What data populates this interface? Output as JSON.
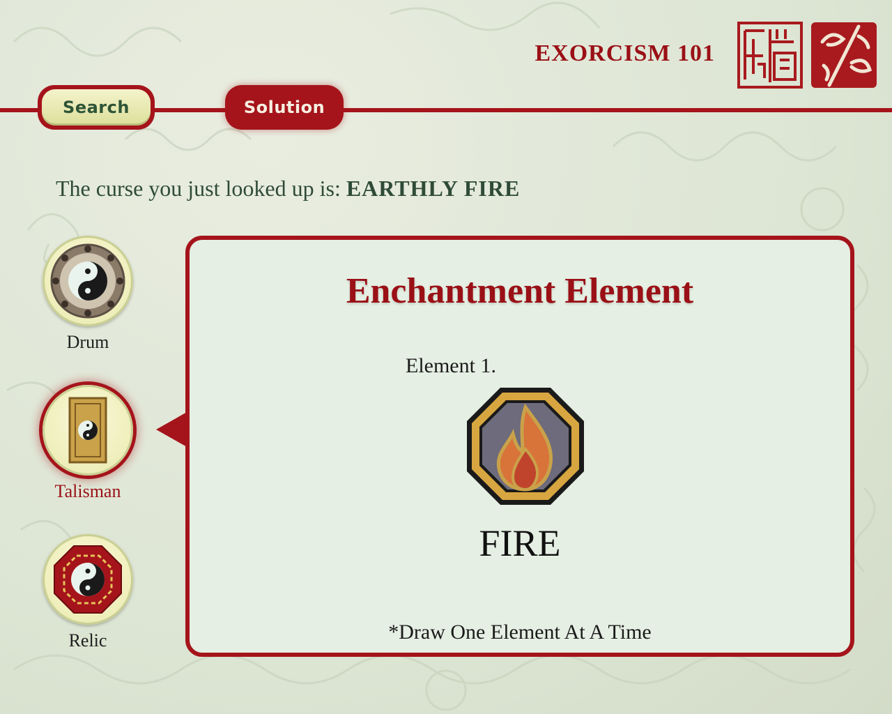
{
  "header": {
    "title": "EXORCISM 101",
    "tabs": {
      "search_label": "Search",
      "solution_label": "Solution"
    }
  },
  "curse": {
    "prefix": "The curse you just looked up is:",
    "name": "EARTHLY FIRE"
  },
  "nav": {
    "items": [
      {
        "label": "Drum",
        "icon": "drum-icon",
        "selected": false
      },
      {
        "label": "Talisman",
        "icon": "talisman-icon",
        "selected": true
      },
      {
        "label": "Relic",
        "icon": "relic-icon",
        "selected": false
      }
    ]
  },
  "panel": {
    "title": "Enchantment Element",
    "element_label": "Element 1.",
    "element_icon": "fire-element-icon",
    "element_name": "FIRE",
    "note": "*Draw One Element At A Time"
  },
  "colors": {
    "accent_red": "#a5141b",
    "title_red": "#9a1016",
    "text_green": "#2f4b38",
    "search_text": "#2f5436",
    "panel_bg": "#e5efe3",
    "page_bg": "#dde5d4"
  }
}
